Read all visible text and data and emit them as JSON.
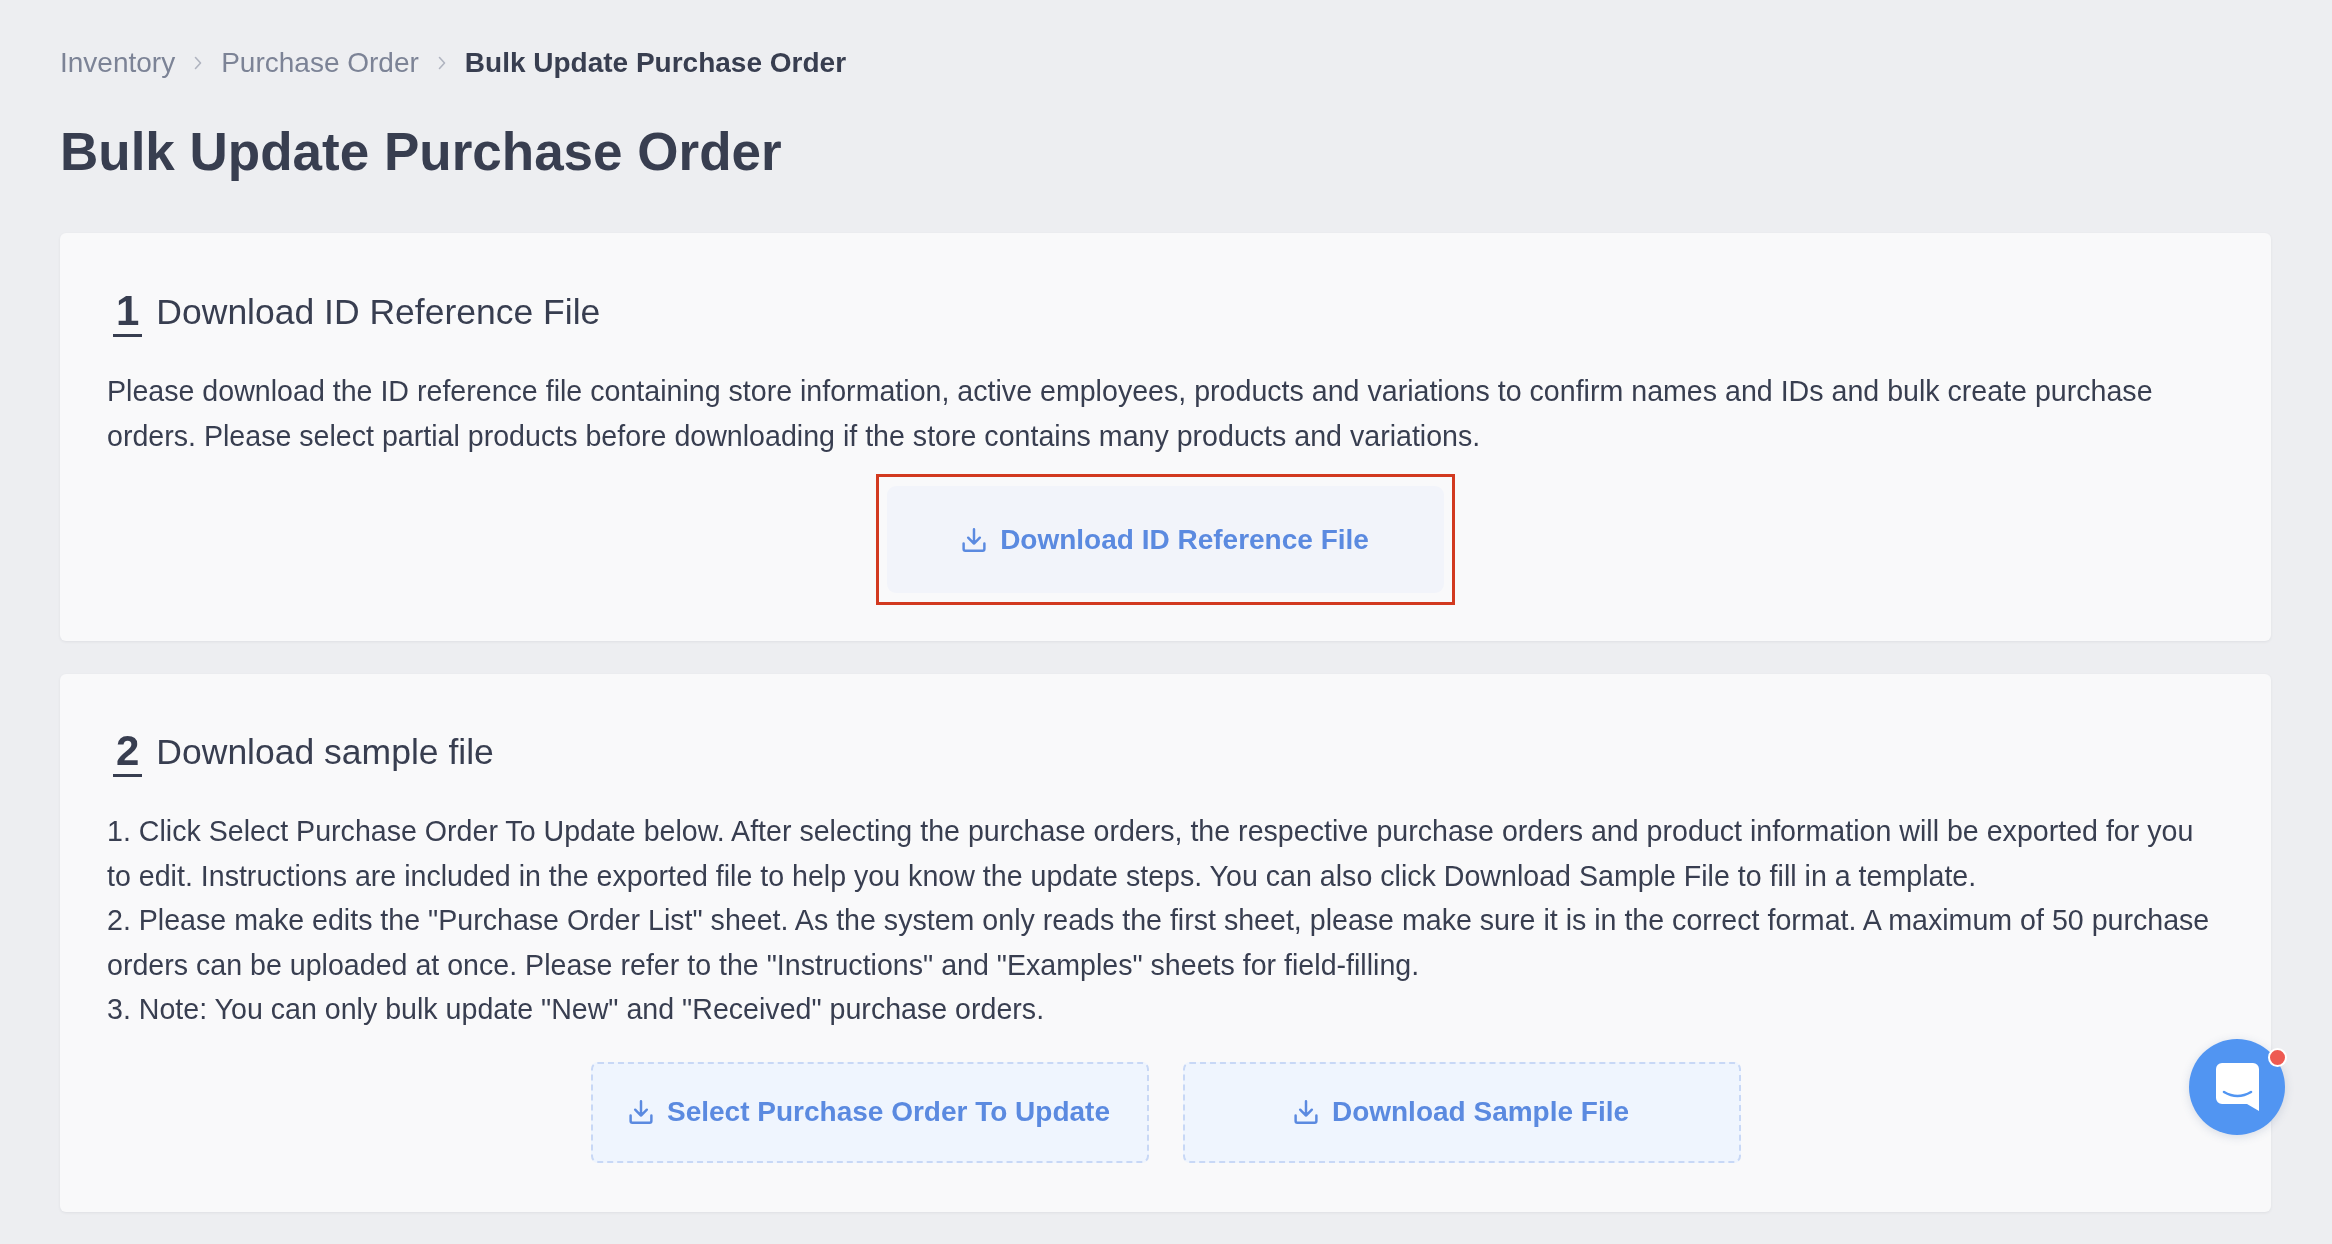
{
  "breadcrumb": [
    {
      "label": "Inventory",
      "current": false
    },
    {
      "label": "Purchase Order",
      "current": false
    },
    {
      "label": "Bulk Update Purchase Order",
      "current": true
    }
  ],
  "page_title": "Bulk Update Purchase Order",
  "steps": [
    {
      "number": "1",
      "title": "Download ID Reference File",
      "paragraphs": [
        "Please download the ID reference file containing store information, active employees, products and variations to confirm names and IDs and bulk create purchase orders. Please select partial products before downloading if the store contains many products and variations."
      ],
      "buttons": [
        {
          "label": "Download ID Reference File",
          "kind": "solid",
          "highlighted": true
        }
      ]
    },
    {
      "number": "2",
      "title": "Download sample file",
      "paragraphs": [
        "1. Click Select Purchase Order To Update below. After selecting the purchase orders, the respective purchase orders and product information will be exported for you to edit. Instructions are included in the exported file to help you know the update steps. You can also click Download Sample File to fill in a template.",
        "2. Please make edits the \"Purchase Order List\" sheet. As the system only reads the first sheet, please make sure it is in the correct format. A maximum of 50 purchase orders can be uploaded at once. Please refer to the \"Instructions\" and \"Examples\" sheets for field-filling.",
        "3. Note: You can only bulk update \"New\" and \"Received\" purchase orders."
      ],
      "buttons": [
        {
          "label": "Select Purchase Order To Update",
          "kind": "dashed"
        },
        {
          "label": "Download Sample File",
          "kind": "dashed"
        }
      ]
    }
  ],
  "chat": {
    "unread": true
  }
}
